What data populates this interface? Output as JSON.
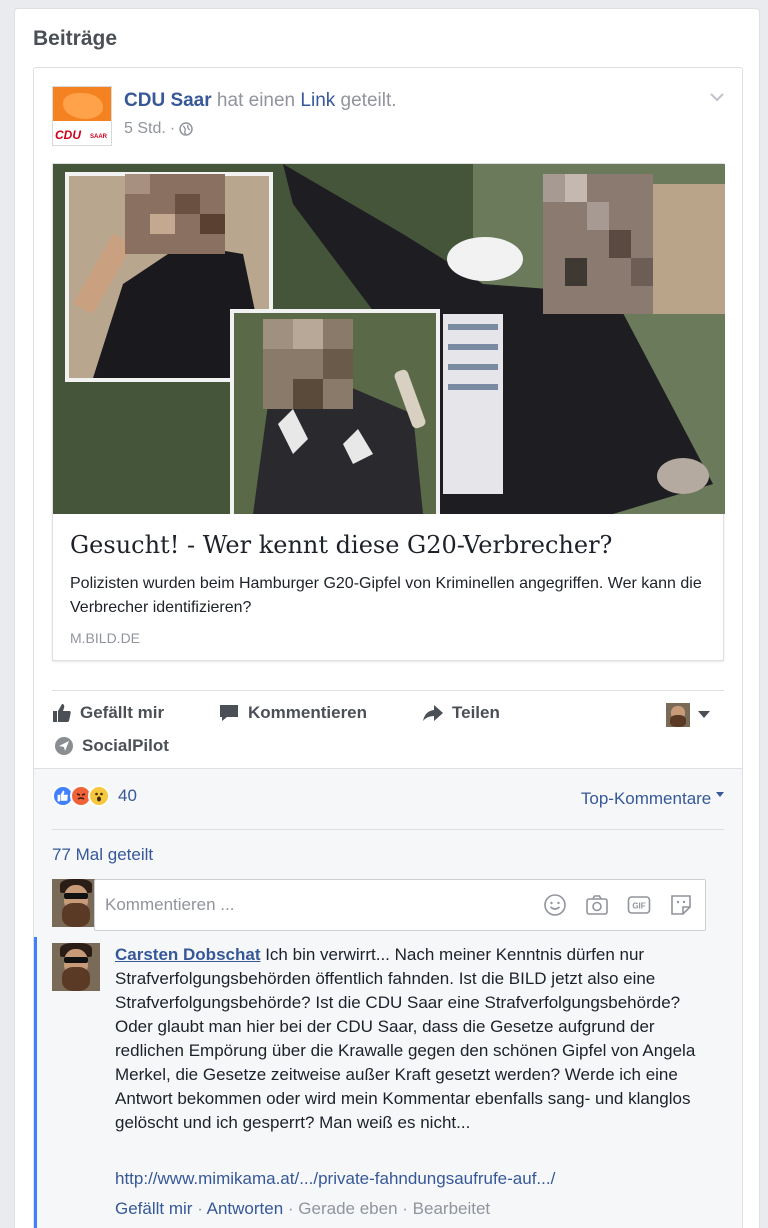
{
  "section": {
    "title": "Beiträge"
  },
  "post": {
    "page_name": "CDU Saar",
    "action_text_1": " hat einen ",
    "link_word": "Link",
    "action_text_2": " geteilt.",
    "time": "5 Std.",
    "meta_sep": "·",
    "logo_text": "CDU",
    "logo_sub": "SAAR",
    "link": {
      "title": "Gesucht! - Wer kennt diese G20-Verbrecher?",
      "description": "Polizisten wurden beim Hamburger G20-Gipfel von Kriminellen angegriffen. Wer kann die Verbrecher identifizieren?",
      "domain": "M.BILD.DE"
    }
  },
  "actions": {
    "like": "Gefällt mir",
    "comment": "Kommentieren",
    "share": "Teilen",
    "socialpilot": "SocialPilot"
  },
  "reactions": {
    "count": "40",
    "top_comments": "Top-Kommentare",
    "shares": "77 Mal geteilt"
  },
  "comment_input": {
    "placeholder": "Kommentieren ..."
  },
  "comment": {
    "author": "Carsten Dobschat",
    "text": " Ich bin verwirrt... Nach meiner Kenntnis dürfen nur Strafverfolgungsbehörden öffentlich fahnden. Ist die BILD jetzt also eine Strafverfolgungsbehörde? Ist die CDU Saar eine Strafverfolgungsbehörde? Oder glaubt man hier bei der CDU Saar, dass die Gesetze aufgrund der redlichen Empörung über die Krawalle gegen den schönen Gipfel von Angela Merkel, die Gesetze zeitweise außer Kraft gesetzt werden? Werde ich eine Antwort bekommen oder wird mein Kommentar ebenfalls sang- und klanglos gelöscht und ich gesperrt? Man weiß es nicht...",
    "link": "http://www.mimikama.at/.../private-fahndungsaufrufe-auf.../",
    "like": "Gefällt mir",
    "reply": "Antworten",
    "time": "Gerade eben",
    "edited": "Bearbeitet",
    "sep": " · "
  },
  "colors": {
    "link": "#365899",
    "accent": "#4080ff",
    "logo": "#f58220"
  }
}
